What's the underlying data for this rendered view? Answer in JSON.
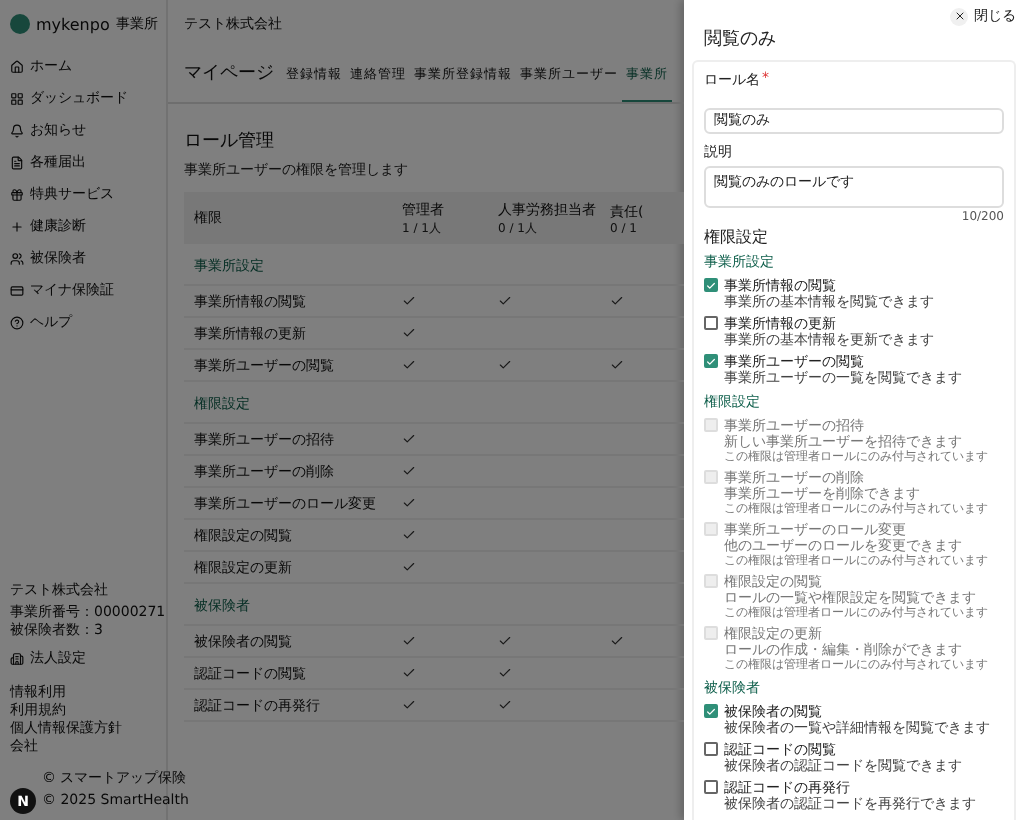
{
  "sidebar": {
    "brand": "mykenpo",
    "brand_tag": "事業所",
    "items": [
      {
        "label": "ホーム",
        "selected": false
      },
      {
        "label": "ダッシュボード",
        "selected": false
      },
      {
        "label": "お知らせ",
        "selected": false
      },
      {
        "label": "各種届出",
        "selected": false
      },
      {
        "label": "特典サービス",
        "selected": false
      },
      {
        "label": "健康診断",
        "selected": false
      },
      {
        "label": "被保険者",
        "selected": false
      },
      {
        "label": "マイナ保険証",
        "selected": false
      },
      {
        "label": "ヘルプ",
        "selected": false
      }
    ],
    "company": "テスト株式会社",
    "info": [
      "事業所番号：00000271",
      "被保険者数：3"
    ],
    "settings_link": "法人設定",
    "footer_links": [
      "情報利用",
      "利用規約",
      "個人情報保護方針",
      "会社"
    ],
    "copyright": [
      "© スマートアップ保険",
      "© 2025 SmartHealth"
    ],
    "dev_badge": "N"
  },
  "header": {
    "company": "テスト株式会社"
  },
  "page": {
    "title": "マイページ",
    "tabs": [
      {
        "label": "登録情報",
        "selected": false
      },
      {
        "label": "連絡管理",
        "selected": false
      },
      {
        "label": "事業所登録情報",
        "selected": false
      },
      {
        "label": "事業所ユーザー",
        "selected": false
      },
      {
        "label": "事業所",
        "selected": true
      }
    ],
    "section_title": "ロール管理",
    "section_subtitle": "事業所ユーザーの権限を管理します",
    "table": {
      "first_column": "権限",
      "columns": [
        {
          "name": "管理者",
          "sub": "1 / 1人"
        },
        {
          "name": "人事労務担当者",
          "sub": "0 / 1人"
        },
        {
          "name": "責任(",
          "sub": "0 / 1"
        }
      ],
      "groups": [
        {
          "title": "事業所設定",
          "rows": [
            {
              "label": "事業所情報の閲覧",
              "cells": [
                true,
                true,
                true
              ]
            },
            {
              "label": "事業所情報の更新",
              "cells": [
                true,
                false,
                false
              ]
            },
            {
              "label": "事業所ユーザーの閲覧",
              "cells": [
                true,
                true,
                true
              ]
            }
          ]
        },
        {
          "title": "権限設定",
          "rows": [
            {
              "label": "事業所ユーザーの招待",
              "cells": [
                true,
                false,
                false
              ]
            },
            {
              "label": "事業所ユーザーの削除",
              "cells": [
                true,
                false,
                false
              ]
            },
            {
              "label": "事業所ユーザーのロール変更",
              "cells": [
                true,
                false,
                false
              ]
            },
            {
              "label": "権限設定の閲覧",
              "cells": [
                true,
                false,
                false
              ]
            },
            {
              "label": "権限設定の更新",
              "cells": [
                true,
                false,
                false
              ]
            }
          ]
        },
        {
          "title": "被保険者",
          "rows": [
            {
              "label": "被保険者の閲覧",
              "cells": [
                true,
                true,
                true
              ]
            },
            {
              "label": "認証コードの閲覧",
              "cells": [
                true,
                true,
                false
              ]
            },
            {
              "label": "認証コードの再発行",
              "cells": [
                true,
                true,
                false
              ]
            }
          ]
        }
      ]
    }
  },
  "drawer": {
    "close": "閉じる",
    "title": "閲覧のみ",
    "name_label": "ロール名",
    "required_mark": "*",
    "name_value": "閲覧のみ",
    "desc_label": "説明",
    "desc_value": "閲覧のみのロールです",
    "counter": "10/200",
    "permissions_title": "権限設定",
    "groups": [
      {
        "title": "事業所設定",
        "items": [
          {
            "label": "事業所情報の閲覧",
            "desc": "事業所の基本情報を閲覧できます",
            "checked": true,
            "disabled": false
          },
          {
            "label": "事業所情報の更新",
            "desc": "事業所の基本情報を更新できます",
            "checked": false,
            "disabled": false
          },
          {
            "label": "事業所ユーザーの閲覧",
            "desc": "事業所ユーザーの一覧を閲覧できます",
            "checked": true,
            "disabled": false
          }
        ]
      },
      {
        "title": "権限設定",
        "items": [
          {
            "label": "事業所ユーザーの招待",
            "desc": "新しい事業所ユーザーを招待できます",
            "note": "この権限は管理者ロールにのみ付与されています",
            "checked": false,
            "disabled": true
          },
          {
            "label": "事業所ユーザーの削除",
            "desc": "事業所ユーザーを削除できます",
            "note": "この権限は管理者ロールにのみ付与されています",
            "checked": false,
            "disabled": true
          },
          {
            "label": "事業所ユーザーのロール変更",
            "desc": "他のユーザーのロールを変更できます",
            "note": "この権限は管理者ロールにのみ付与されています",
            "checked": false,
            "disabled": true
          },
          {
            "label": "権限設定の閲覧",
            "desc": "ロールの一覧や権限設定を閲覧できます",
            "note": "この権限は管理者ロールにのみ付与されています",
            "checked": false,
            "disabled": true
          },
          {
            "label": "権限設定の更新",
            "desc": "ロールの作成・編集・削除ができます",
            "note": "この権限は管理者ロールにのみ付与されています",
            "checked": false,
            "disabled": true
          }
        ]
      },
      {
        "title": "被保険者",
        "items": [
          {
            "label": "被保険者の閲覧",
            "desc": "被保険者の一覧や詳細情報を閲覧できます",
            "checked": true,
            "disabled": false
          },
          {
            "label": "認証コードの閲覧",
            "desc": "被保険者の認証コードを閲覧できます",
            "checked": false,
            "disabled": false
          },
          {
            "label": "認証コードの再発行",
            "desc": "被保険者の認証コードを再発行できます",
            "checked": false,
            "disabled": false
          }
        ]
      }
    ]
  }
}
